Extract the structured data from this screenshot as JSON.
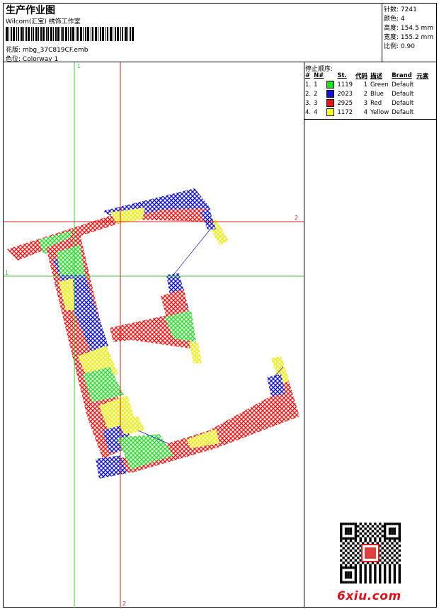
{
  "header": {
    "title": "生产作业图",
    "company": "Wilcom(汇宝) 绣饰工作室",
    "design_label": "花版:",
    "design_value": "mbg_37C819CF.emb",
    "colorway_label": "色位:",
    "colorway_value": "Colorway 1"
  },
  "stats": [
    {
      "label": "针数:",
      "value": "7241"
    },
    {
      "label": "颜色:",
      "value": "4"
    },
    {
      "label": "高度:",
      "value": "154.5 mm"
    },
    {
      "label": "宽度:",
      "value": "155.2 mm"
    },
    {
      "label": "比例:",
      "value": "0.90"
    }
  ],
  "stop_sequence": {
    "header": "停止顺序:",
    "columns": [
      "#",
      "N#",
      "St.",
      "代码",
      "描述",
      "Brand",
      "元素"
    ],
    "rows": [
      {
        "num": "1.",
        "n": "1",
        "color": "#22dd22",
        "st": "1119",
        "code": "1",
        "desc": "Green",
        "brand": "Default"
      },
      {
        "num": "2.",
        "n": "2",
        "color": "#1111cc",
        "st": "2023",
        "code": "2",
        "desc": "Blue",
        "brand": "Default"
      },
      {
        "num": "3.",
        "n": "3",
        "color": "#ee1111",
        "st": "2925",
        "code": "3",
        "desc": "Red",
        "brand": "Default"
      },
      {
        "num": "4.",
        "n": "4",
        "color": "#ffff22",
        "st": "1172",
        "code": "4",
        "desc": "Yellow",
        "brand": "Default"
      }
    ]
  },
  "axes": {
    "green_v": "1",
    "green_h": "1",
    "red_h": "2",
    "red_v": "2"
  },
  "colors": {
    "green": "#22dd22",
    "blue": "#1111cc",
    "red": "#ee1111",
    "yellow": "#ffff22",
    "guide_green": "#33cc33",
    "guide_red": "#dd2222"
  },
  "watermark": "6xiu.com"
}
